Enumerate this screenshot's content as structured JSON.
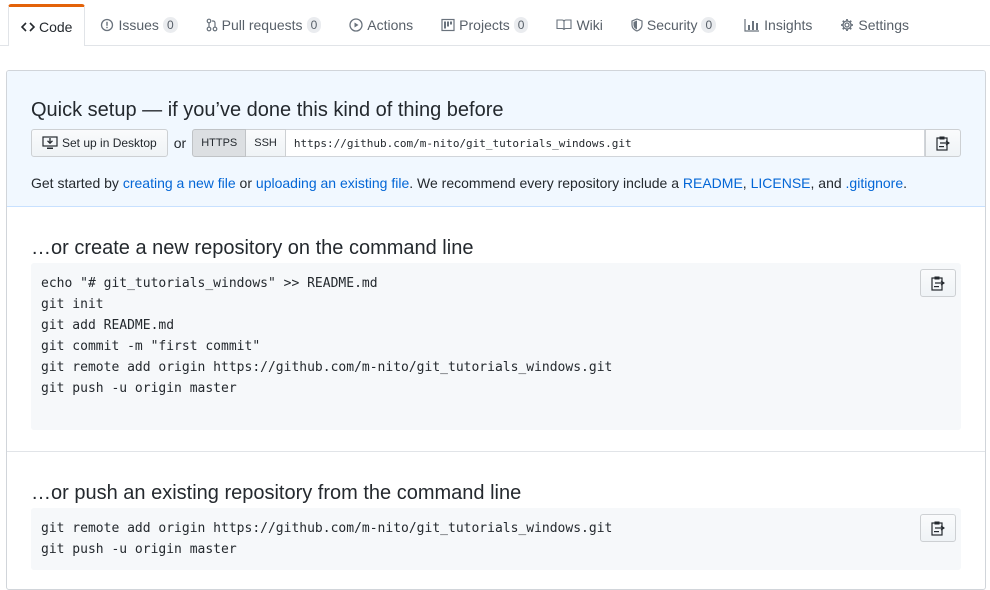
{
  "tabs": [
    {
      "label": "Code",
      "icon": "code-icon",
      "counter": null
    },
    {
      "label": "Issues",
      "icon": "issue-icon",
      "counter": "0"
    },
    {
      "label": "Pull requests",
      "icon": "pull-request-icon",
      "counter": "0"
    },
    {
      "label": "Actions",
      "icon": "play-icon",
      "counter": null
    },
    {
      "label": "Projects",
      "icon": "project-icon",
      "counter": "0"
    },
    {
      "label": "Wiki",
      "icon": "book-icon",
      "counter": null
    },
    {
      "label": "Security",
      "icon": "shield-icon",
      "counter": "0"
    },
    {
      "label": "Insights",
      "icon": "graph-icon",
      "counter": null
    },
    {
      "label": "Settings",
      "icon": "gear-icon",
      "counter": null
    }
  ],
  "quick_setup": {
    "title": "Quick setup — if you’ve done this kind of thing before",
    "desktop_button": "Set up in Desktop",
    "or": "or",
    "https_label": "HTTPS",
    "ssh_label": "SSH",
    "clone_url": "https://github.com/m-nito/git_tutorials_windows.git",
    "get_started": {
      "t1": "Get started by ",
      "link_new_file": "creating a new file",
      "t2": " or ",
      "link_upload": "uploading an existing file",
      "t3": ". We recommend every repository include a ",
      "link_readme": "README",
      "t4": ", ",
      "link_license": "LICENSE",
      "t5": ", and ",
      "link_gitignore": ".gitignore",
      "t6": "."
    }
  },
  "new_repo": {
    "title": "…or create a new repository on the command line",
    "lines": [
      "echo \"# git_tutorials_windows\" >> README.md",
      "git init",
      "git add README.md",
      "git commit -m \"first commit\"",
      "git remote add origin https://github.com/m-nito/git_tutorials_windows.git",
      "git push -u origin master"
    ]
  },
  "push_existing": {
    "title": "…or push an existing repository from the command line",
    "lines": [
      "git remote add origin https://github.com/m-nito/git_tutorials_windows.git",
      "git push -u origin master"
    ]
  },
  "colors": {
    "accent_tab": "#e36209",
    "link": "#0366d6",
    "quick_setup_bg": "#f1f8ff"
  }
}
